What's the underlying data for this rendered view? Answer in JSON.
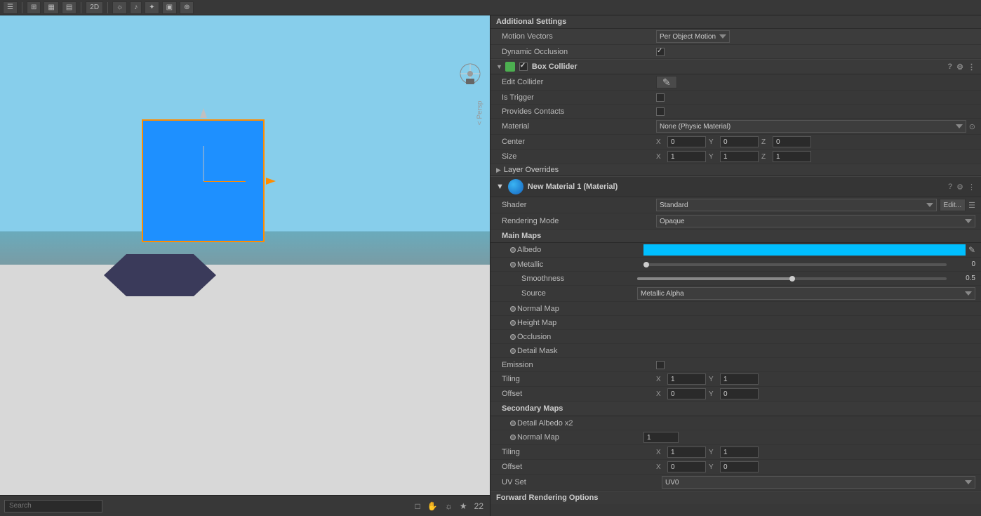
{
  "toolbar": {
    "buttons": [
      "☰",
      "⊞",
      "▦"
    ],
    "mode_2d": "2D",
    "view_btn": "◎",
    "light_btn": "💡",
    "audio_btn": "🔊",
    "fx_btn": "✦",
    "camera_btn": "📷",
    "gizmo_btn": "⊕"
  },
  "scene": {
    "persp_label": "< Persp",
    "search_placeholder": "Search",
    "bottom_icons": [
      "□",
      "✋",
      "☼",
      "★",
      "22"
    ]
  },
  "additional_settings": {
    "title": "Additional Settings",
    "motion_vectors_label": "Motion Vectors",
    "motion_vectors_value": "Per Object Motion",
    "dynamic_occlusion_label": "Dynamic Occlusion",
    "dynamic_occlusion_checked": true
  },
  "box_collider": {
    "title": "Box Collider",
    "edit_collider_label": "Edit Collider",
    "is_trigger_label": "Is Trigger",
    "is_trigger_checked": false,
    "provides_contacts_label": "Provides Contacts",
    "provides_contacts_checked": false,
    "material_label": "Material",
    "material_value": "None (Physic Material)",
    "center_label": "Center",
    "center_x": "0",
    "center_y": "0",
    "center_z": "0",
    "size_label": "Size",
    "size_x": "1",
    "size_y": "1",
    "size_z": "1"
  },
  "layer_overrides": {
    "label": "Layer Overrides"
  },
  "material": {
    "title": "New Material 1 (Material)",
    "shader_label": "Shader",
    "shader_value": "Standard",
    "edit_btn": "Edit...",
    "rendering_mode_label": "Rendering Mode",
    "rendering_mode_value": "Opaque",
    "main_maps_label": "Main Maps",
    "albedo_label": "Albedo",
    "albedo_color": "#00BFFF",
    "metallic_label": "Metallic",
    "metallic_value": "0",
    "metallic_slider_pct": 0,
    "smoothness_label": "Smoothness",
    "smoothness_value": "0.5",
    "smoothness_slider_pct": 50,
    "source_label": "Source",
    "source_value": "Metallic Alpha",
    "normal_map_label": "Normal Map",
    "height_map_label": "Height Map",
    "occlusion_label": "Occlusion",
    "detail_mask_label": "Detail Mask",
    "emission_label": "Emission",
    "emission_checked": false,
    "tiling_label": "Tiling",
    "tiling_x": "1",
    "tiling_y": "1",
    "offset_label": "Offset",
    "offset_x": "0",
    "offset_y": "0",
    "secondary_maps_label": "Secondary Maps",
    "detail_albedo_label": "Detail Albedo x2",
    "sec_normal_map_label": "Normal Map",
    "sec_normal_value": "1",
    "sec_tiling_x": "1",
    "sec_tiling_y": "1",
    "sec_offset_x": "0",
    "sec_offset_y": "0",
    "uv_set_label": "UV Set",
    "uv_set_value": "UV0",
    "forward_rendering_label": "Forward Rendering Options"
  }
}
